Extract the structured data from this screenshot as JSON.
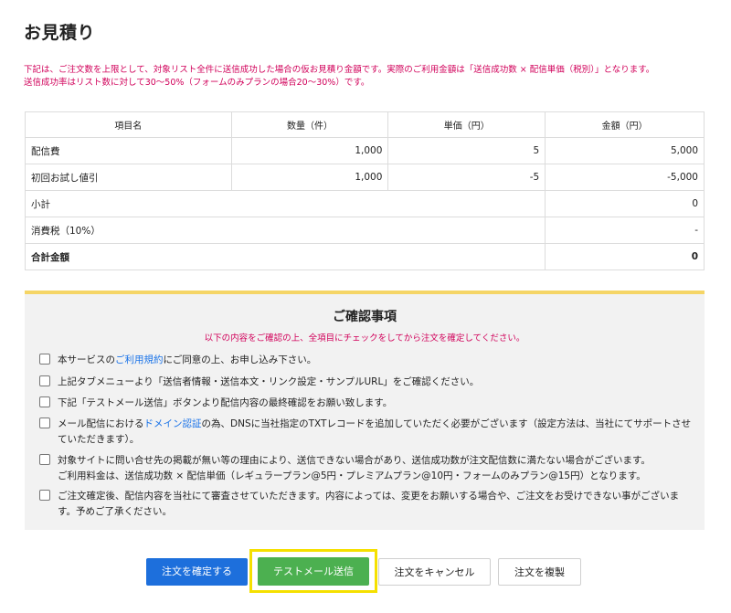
{
  "page": {
    "title": "お見積り",
    "notice_line1": "下記は、ご注文数を上限として、対象リスト全件に送信成功した場合の仮お見積り金額です。実際のご利用金額は「送信成功数 × 配信単価（税別）」となります。",
    "notice_line2": "送信成功率はリスト数に対して30〜50%（フォームのみプランの場合20〜30%）です。"
  },
  "table": {
    "headers": [
      "項目名",
      "数量（件）",
      "単価（円）",
      "金額（円）"
    ],
    "rows": [
      {
        "name": "配信費",
        "qty": "1,000",
        "unit": "5",
        "amount": "5,000"
      },
      {
        "name": "初回お試し値引",
        "qty": "1,000",
        "unit": "-5",
        "amount": "-5,000"
      }
    ],
    "subtotal": {
      "label": "小計",
      "amount": "0"
    },
    "tax": {
      "label": "消費税（10%）",
      "amount": "-"
    },
    "total": {
      "label": "合計金額",
      "amount": "0"
    }
  },
  "confirm": {
    "title": "ご確認事項",
    "subtitle": "以下の内容をご確認の上、全項目にチェックをしてから注文を確定してください。",
    "items": [
      {
        "pre": "本サービスの",
        "link": "ご利用規約",
        "post": "にご同意の上、お申し込み下さい。"
      },
      {
        "text": "上記タブメニューより「送信者情報・送信本文・リンク設定・サンプルURL」をご確認ください。"
      },
      {
        "text": "下記「テストメール送信」ボタンより配信内容の最終確認をお願い致します。"
      },
      {
        "pre": "メール配信における",
        "link": "ドメイン認証",
        "post": "の為、DNSに当社指定のTXTレコードを追加していただく必要がございます（設定方法は、当社にてサポートさせていただきます）。"
      },
      {
        "text": "対象サイトに問い合せ先の掲載が無い等の理由により、送信できない場合があり、送信成功数が注文配信数に満たない場合がございます。",
        "text2": "ご利用料金は、送信成功数 × 配信単価（レギュラープラン@5円・プレミアムプラン@10円・フォームのみプラン@15円）となります。"
      },
      {
        "text": "ご注文確定後、配信内容を当社にて審査させていただきます。内容によっては、変更をお願いする場合や、ご注文をお受けできない事がございます。予めご了承ください。"
      }
    ]
  },
  "buttons": {
    "confirm": "注文を確定する",
    "test_mail": "テストメール送信",
    "cancel": "注文をキャンセル",
    "copy": "注文を複製"
  },
  "colors": {
    "notice": "#d1005a",
    "primary": "#1d6fdc",
    "test_button": "#4cb050",
    "highlight": "#f5e000",
    "link": "#1a73e8"
  }
}
